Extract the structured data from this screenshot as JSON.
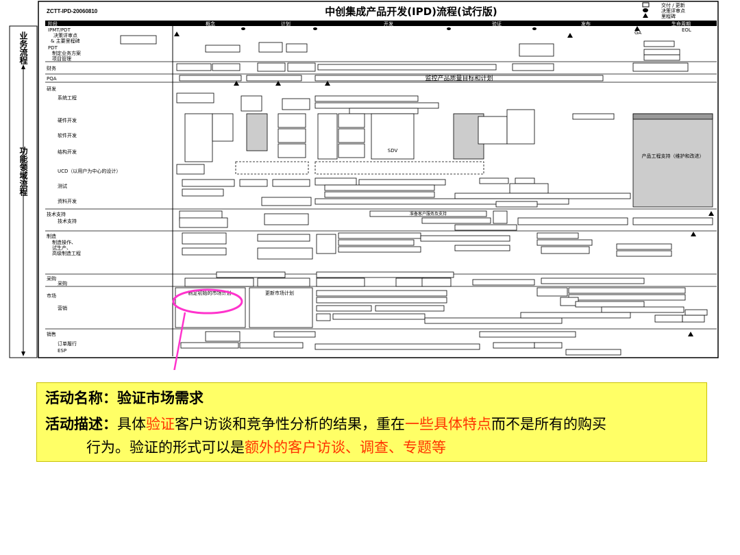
{
  "doc_id": "ZCTT-IPD-20060810",
  "title": "中创集成产品开发(IPD)流程(试行版)",
  "legend": [
    "交付 / 更新",
    "决策评审点",
    "里程碑"
  ],
  "phases": [
    "阶段",
    "概念",
    "计划",
    "开发",
    "验证",
    "发布",
    "生命周期"
  ],
  "side_labels": {
    "top": "业务流程",
    "bottom": "功能领域流程"
  },
  "rows": [
    {
      "label": "IPMT/PDT\n决策评审点\n& 主要里程碑",
      "sub": ""
    },
    {
      "label": "PDT\n制定业务方案\n项目管理",
      "sub": ""
    },
    {
      "label": "财务",
      "sub": ""
    },
    {
      "label": "PQA",
      "sub": ""
    },
    {
      "label": "研发",
      "sub": "系统工程"
    },
    {
      "label": "",
      "sub": "硬件开发"
    },
    {
      "label": "",
      "sub": "软件开发"
    },
    {
      "label": "",
      "sub": "结构开发"
    },
    {
      "label": "",
      "sub": "UCD（以用户为中心的设计）"
    },
    {
      "label": "",
      "sub": "测试"
    },
    {
      "label": "",
      "sub": "资料开发"
    },
    {
      "label": "技术支持",
      "sub": "技术支持"
    },
    {
      "label": "制造",
      "sub": "制造操作、\n试生产、\n高级制造工程"
    },
    {
      "label": "采购",
      "sub": "采购"
    },
    {
      "label": "市场",
      "sub": "营销"
    },
    {
      "label": "销售",
      "sub": "订单履行\nESP"
    }
  ],
  "boxes": {
    "pqa_bar": "监控产品质量目标和计划",
    "market_box1": "制定初始的市场计划",
    "market_box2": "更新市场计划",
    "sdv": "SDV",
    "tech_support_box": "准备客户服务及支持",
    "product_eng": "产品工程支持（维护和改进）",
    "ga": "GA",
    "eol": "EOL"
  },
  "callout": {
    "name_label": "活动名称：",
    "name_value": "验证市场需求",
    "desc_label": "活动描述：",
    "desc_seg1": "具体",
    "desc_hl1": "验证",
    "desc_seg2": "客户访谈和竞争性分析的结果，重在",
    "desc_hl2": "一些具体特点",
    "desc_seg3": "而不是所有的购买",
    "desc_line2_a": "行为。验证的形式可以是",
    "desc_hl3": "额外的客户访谈、调查、专题等"
  },
  "colors": {
    "highlight": "#ff3300",
    "circle": "#ff33cc",
    "callout_bg": "#ffff66",
    "phase_bar": "#000000"
  }
}
